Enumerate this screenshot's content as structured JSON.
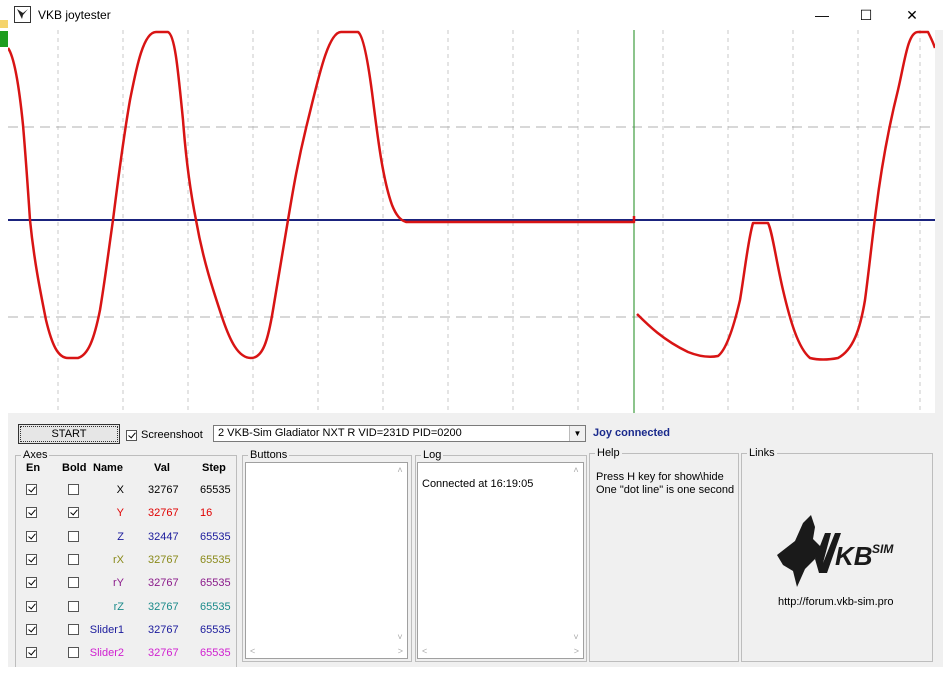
{
  "window": {
    "title": "VKB joytester",
    "minimize": "—",
    "maximize": "☐",
    "close": "✕"
  },
  "toolbar": {
    "start_label": "START",
    "screenshoot_label": "Screenshoot",
    "screenshoot_checked": true,
    "device": "2  VKB-Sim Gladiator NXT R   VID=231D PID=0200",
    "status": "Joy connected"
  },
  "axes": {
    "legend": "Axes",
    "headers": {
      "en": "En",
      "bold": "Bold",
      "name": "Name",
      "val": "Val",
      "step": "Step"
    },
    "rows": [
      {
        "en": true,
        "bold": false,
        "name": "X",
        "val": "32767",
        "step": "65535",
        "color": "#000000"
      },
      {
        "en": true,
        "bold": true,
        "name": "Y",
        "val": "32767",
        "step": "16",
        "color": "#e00000"
      },
      {
        "en": true,
        "bold": false,
        "name": "Z",
        "val": "32447",
        "step": "65535",
        "color": "#1a1a9c"
      },
      {
        "en": true,
        "bold": false,
        "name": "rX",
        "val": "32767",
        "step": "65535",
        "color": "#8a8a1a"
      },
      {
        "en": true,
        "bold": false,
        "name": "rY",
        "val": "32767",
        "step": "65535",
        "color": "#8a1a8a"
      },
      {
        "en": true,
        "bold": false,
        "name": "rZ",
        "val": "32767",
        "step": "65535",
        "color": "#1a8a8a"
      },
      {
        "en": true,
        "bold": false,
        "name": "Slider1",
        "val": "32767",
        "step": "65535",
        "color": "#1a1a9c"
      },
      {
        "en": true,
        "bold": false,
        "name": "Slider2",
        "val": "32767",
        "step": "65535",
        "color": "#d020d0"
      }
    ]
  },
  "buttons": {
    "legend": "Buttons"
  },
  "log": {
    "legend": "Log",
    "lines": [
      "Connected at 16:19:05"
    ]
  },
  "help": {
    "legend": "Help",
    "line1": "Press H key for show\\hide",
    "line2": "One \"dot line\" is one second"
  },
  "links": {
    "legend": "Links",
    "logo_text": "VKB SIM",
    "url": "http://forum.vkb-sim.pro"
  },
  "scope": {
    "trace_color": "#d81414",
    "baseline_color": "#1a237e",
    "cursor_color": "#1a8a1a"
  }
}
